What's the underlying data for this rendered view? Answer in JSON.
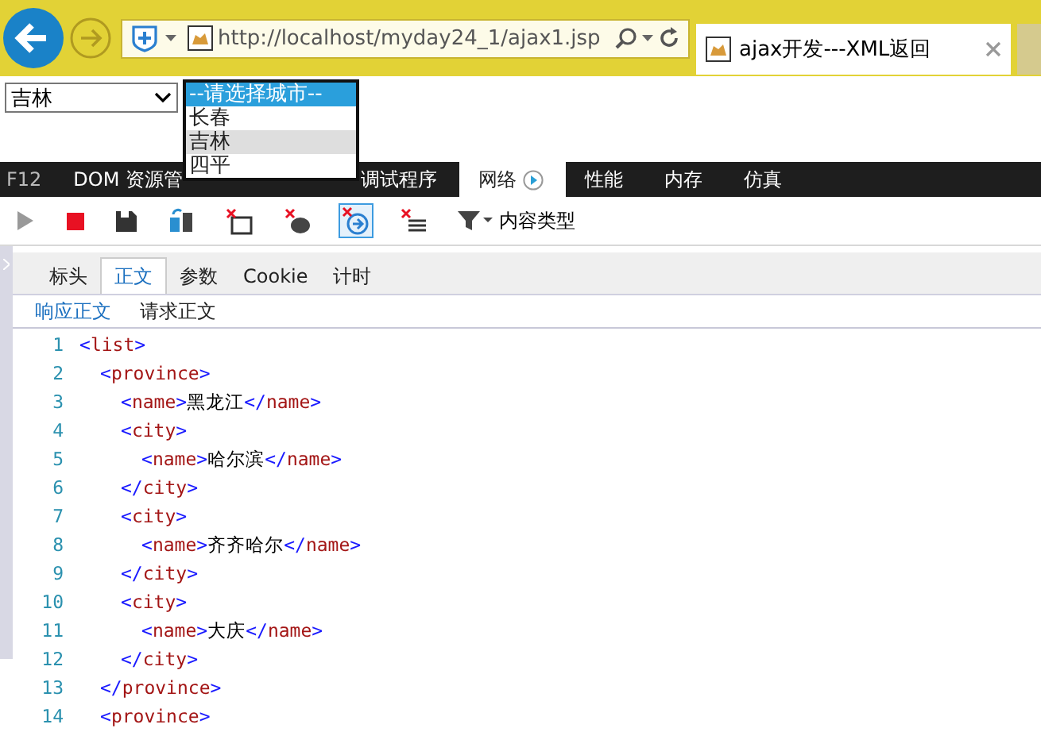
{
  "browser": {
    "url": "http://localhost/myday24_1/ajax1.jsp",
    "tab_title": "ajax开发---XML返回"
  },
  "page": {
    "select_value": "吉林",
    "dropdown": [
      {
        "label": "--请选择城市--",
        "selected": true,
        "hover": false
      },
      {
        "label": "长春",
        "selected": false,
        "hover": false
      },
      {
        "label": "吉林",
        "selected": false,
        "hover": true
      },
      {
        "label": "四平",
        "selected": false,
        "hover": false
      }
    ]
  },
  "devtools": {
    "label": "F12",
    "tabs": [
      {
        "label": "DOM 资源管",
        "selected": false,
        "play": false
      },
      {
        "label": "调试程序",
        "selected": false,
        "play": false
      },
      {
        "label": "网络",
        "selected": true,
        "play": true
      },
      {
        "label": "性能",
        "selected": false,
        "play": false
      },
      {
        "label": "内存",
        "selected": false,
        "play": false
      },
      {
        "label": "仿真",
        "selected": false,
        "play": false
      }
    ],
    "filter_label": "内容类型",
    "detail_tabs": [
      {
        "label": "标头",
        "selected": false
      },
      {
        "label": "正文",
        "selected": true
      },
      {
        "label": "参数",
        "selected": false
      },
      {
        "label": "Cookie",
        "selected": false
      },
      {
        "label": "计时",
        "selected": false
      }
    ],
    "body_tabs": [
      {
        "label": "响应正文",
        "selected": true
      },
      {
        "label": "请求正文",
        "selected": false
      }
    ],
    "code": [
      {
        "number": "1",
        "text": "<list>",
        "children": [
          {
            "number": "2",
            "text": "<province>",
            "children": [
              {
                "number": "3",
                "text": "<name>黑龙江</name>"
              },
              {
                "number": "4",
                "text": "<city>",
                "children": [
                  {
                    "number": "5",
                    "text": "<name>哈尔滨</name>"
                  }
                ]
              },
              {
                "number": "6",
                "text": "</city>"
              },
              {
                "number": "7",
                "text": "<city>",
                "children": [
                  {
                    "number": "8",
                    "text": "<name>齐齐哈尔</name>"
                  }
                ]
              },
              {
                "number": "9",
                "text": "</city>"
              },
              {
                "number": "10",
                "text": "<city>",
                "children": [
                  {
                    "number": "11",
                    "text": "<name>大庆</name>"
                  }
                ]
              },
              {
                "number": "12",
                "text": "</city>"
              }
            ]
          },
          {
            "number": "13",
            "text": "</province>"
          },
          {
            "number": "14",
            "text": "<province>"
          }
        ]
      }
    ]
  }
}
